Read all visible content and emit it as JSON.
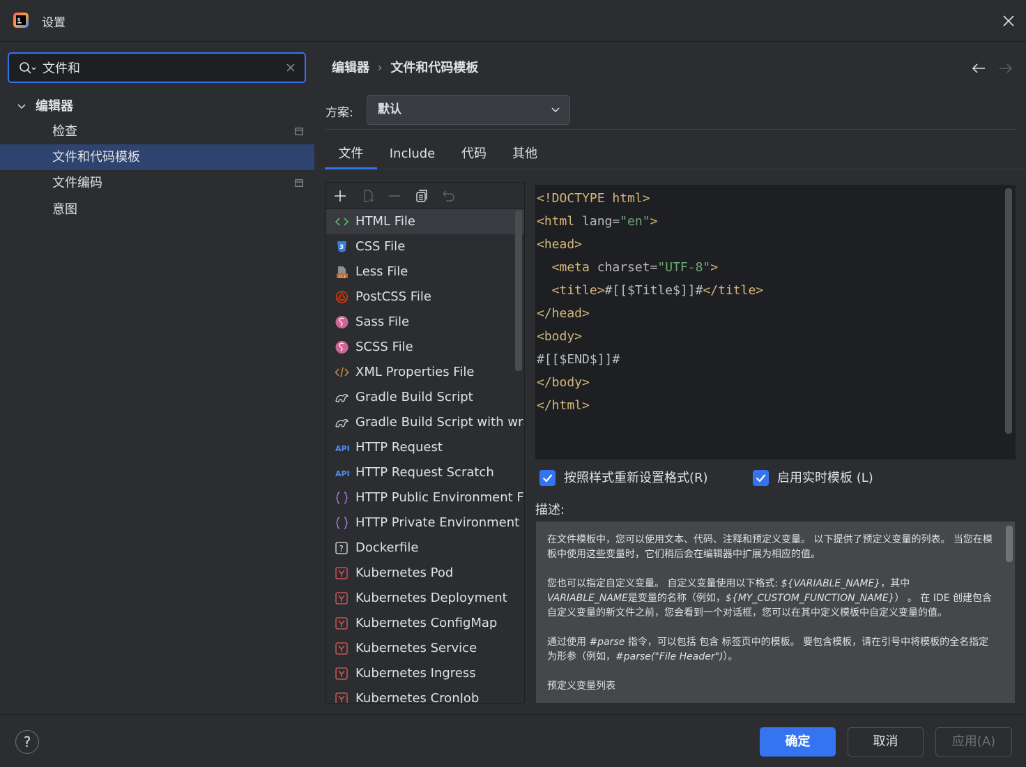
{
  "window": {
    "title": "设置"
  },
  "sidebar": {
    "search": {
      "value": "文件和"
    },
    "items": [
      {
        "label": "编辑器"
      },
      {
        "label": "检查"
      },
      {
        "label": "文件和代码模板"
      },
      {
        "label": "文件编码"
      },
      {
        "label": "意图"
      }
    ]
  },
  "main": {
    "breadcrumb": [
      "编辑器",
      "文件和代码模板"
    ],
    "breadcrumb_sep": "›",
    "scheme": {
      "label": "方案:",
      "value": "默认"
    },
    "tabs": [
      {
        "label": "文件",
        "active": true
      },
      {
        "label": "Include",
        "active": false
      },
      {
        "label": "代码",
        "active": false
      },
      {
        "label": "其他",
        "active": false
      }
    ],
    "files": [
      {
        "name": "HTML File",
        "icon": "html-icon",
        "selected": true
      },
      {
        "name": "CSS File",
        "icon": "css-icon"
      },
      {
        "name": "Less File",
        "icon": "less-icon"
      },
      {
        "name": "PostCSS File",
        "icon": "postcss-icon"
      },
      {
        "name": "Sass File",
        "icon": "sass-icon"
      },
      {
        "name": "SCSS File",
        "icon": "scss-icon"
      },
      {
        "name": "XML Properties File",
        "icon": "xml-icon"
      },
      {
        "name": "Gradle Build Script",
        "icon": "gradle-icon"
      },
      {
        "name": "Gradle Build Script with wrap",
        "icon": "gradle-icon"
      },
      {
        "name": "HTTP Request",
        "icon": "api-icon"
      },
      {
        "name": "HTTP Request Scratch",
        "icon": "api-icon"
      },
      {
        "name": "HTTP Public Environment Fil",
        "icon": "braces-icon"
      },
      {
        "name": "HTTP Private Environment Fi",
        "icon": "braces-icon"
      },
      {
        "name": "Dockerfile",
        "icon": "docker-icon"
      },
      {
        "name": "Kubernetes Pod",
        "icon": "yaml-icon"
      },
      {
        "name": "Kubernetes Deployment",
        "icon": "yaml-icon"
      },
      {
        "name": "Kubernetes ConfigMap",
        "icon": "yaml-icon"
      },
      {
        "name": "Kubernetes Service",
        "icon": "yaml-icon"
      },
      {
        "name": "Kubernetes Ingress",
        "icon": "yaml-icon"
      },
      {
        "name": "Kubernetes CronJob",
        "icon": "yaml-icon"
      }
    ],
    "code": {
      "l1_tag": "<!DOCTYPE",
      "l1_rest": " html>",
      "l2_open": "<html",
      "l2_attr": " lang=",
      "l2_val": "\"en\"",
      "l2_close": ">",
      "l3": "<head>",
      "l4_open": "  <meta",
      "l4_attr": " charset=",
      "l4_val": "\"UTF-8\"",
      "l4_close": ">",
      "l5_open": "  <title>",
      "l5_text": "#[[$Title$]]#",
      "l5_close": "</title>",
      "l6": "</head>",
      "l7": "<body>",
      "l8": "#[[$END$]]#",
      "l9": "</body>",
      "l10": "</html>"
    },
    "options": {
      "reformat": "按照样式重新设置格式(R)",
      "live_templates": "启用实时模板 (L)"
    },
    "description": {
      "label": "描述:",
      "p1": "在文件模板中，您可以使用文本、代码、注释和预定义变量。 以下提供了预定义变量的列表。 当您在模板中使用这些变量时，它们稍后会在编辑器中扩展为相应的值。",
      "p2_a": "您也可以指定自定义变量。 自定义变量使用以下格式: ",
      "p2_b": "${VARIABLE_NAME}",
      "p2_c": "，其中 ",
      "p2_d": "VARIABLE_NAME",
      "p2_e": "是变量的名称（例如，",
      "p2_f": "${MY_CUSTOM_FUNCTION_NAME}",
      "p2_g": "） 。 在 IDE 创建包含自定义变量的新文件之前，您会看到一个对话框，您可以在其中定义模板中自定义变量的值。",
      "p3_a": "通过使用 ",
      "p3_b": "#parse",
      "p3_c": " 指令，可以包括 包含 标签页中的模板。 要包含模板，请在引号中将模板的全名指定为形参（例如，",
      "p3_d": "#parse(\"File Header\")",
      "p3_e": "）。",
      "p4": "预定义变量列表"
    }
  },
  "footer": {
    "help": "?",
    "ok": "确定",
    "cancel": "取消",
    "apply": "应用(A)"
  },
  "colors": {
    "accent": "#3574f0",
    "selection": "#2e436e",
    "tag": "#d5b778",
    "string": "#6aab73"
  }
}
